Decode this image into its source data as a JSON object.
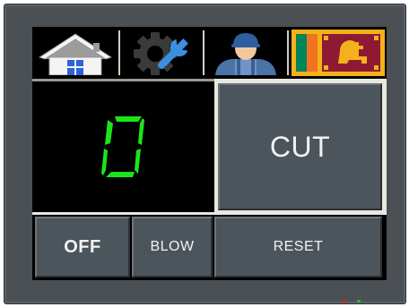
{
  "tabs": [
    {
      "name": "home",
      "icon": "house-icon"
    },
    {
      "name": "settings",
      "icon": "gear-wrench-icon"
    },
    {
      "name": "operator",
      "icon": "worker-icon"
    },
    {
      "name": "language",
      "icon": "sri-lanka-flag-icon"
    }
  ],
  "display": {
    "counter_value": "0",
    "digit_color": "#19e619"
  },
  "buttons": {
    "cut_label": "CUT",
    "off_label": "OFF",
    "blow_label": "BLOW",
    "reset_label": "RESET"
  },
  "indicators": {
    "red_led_color": "#e02020",
    "green_led_color": "#20c030"
  },
  "colors": {
    "bezel": "#4b5055",
    "button_face": "#4d555c",
    "divider": "#e8e8e0"
  }
}
